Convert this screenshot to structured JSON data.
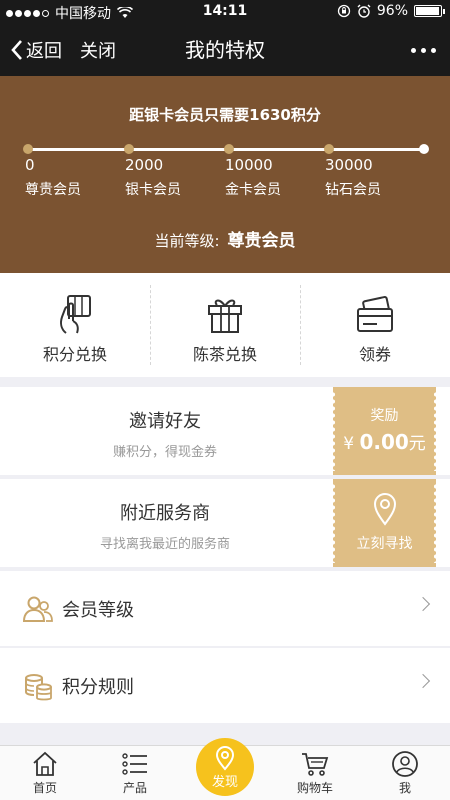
{
  "status_bar": {
    "carrier": "中国移动",
    "time": "14:11",
    "battery": "96%",
    "battery_level": 0.96
  },
  "navbar": {
    "back_label": "返回",
    "close_label": "关闭",
    "title": "我的特权"
  },
  "hero": {
    "headline": "距银卡会员只需要1630积分",
    "tiers": [
      {
        "points": "0",
        "name": "尊贵会员"
      },
      {
        "points": "2000",
        "name": "银卡会员"
      },
      {
        "points": "10000",
        "name": "金卡会员"
      },
      {
        "points": "30000",
        "name": "钻石会员"
      }
    ],
    "level_label": "当前等级:",
    "level_value": "尊贵会员"
  },
  "actions": [
    {
      "label": "积分兑换",
      "icon": "hand-card-icon"
    },
    {
      "label": "陈茶兑换",
      "icon": "gift-icon"
    },
    {
      "label": "领券",
      "icon": "card-icon"
    }
  ],
  "invite": {
    "title": "邀请好友",
    "subtitle": "赚积分，得现金券",
    "reward_label": "奖励",
    "currency": "¥",
    "amount": "0.00",
    "unit": "元"
  },
  "nearby": {
    "title": "附近服务商",
    "subtitle": "寻找离我最近的服务商",
    "action": "立刻寻找"
  },
  "rows": [
    {
      "label": "会员等级",
      "icon": "members-icon"
    },
    {
      "label": "积分规则",
      "icon": "coins-icon"
    }
  ],
  "tabs": [
    {
      "label": "首页",
      "icon": "home-icon"
    },
    {
      "label": "产品",
      "icon": "list-icon"
    },
    {
      "label": "发现",
      "icon": "location-pin-icon"
    },
    {
      "label": "购物车",
      "icon": "cart-icon"
    },
    {
      "label": "我",
      "icon": "user-icon"
    }
  ],
  "colors": {
    "hero_bg": "#7b5331",
    "accent_gold": "#dfbe85",
    "discover_yellow": "#f6c21d",
    "node_gold": "#c9a66b"
  }
}
